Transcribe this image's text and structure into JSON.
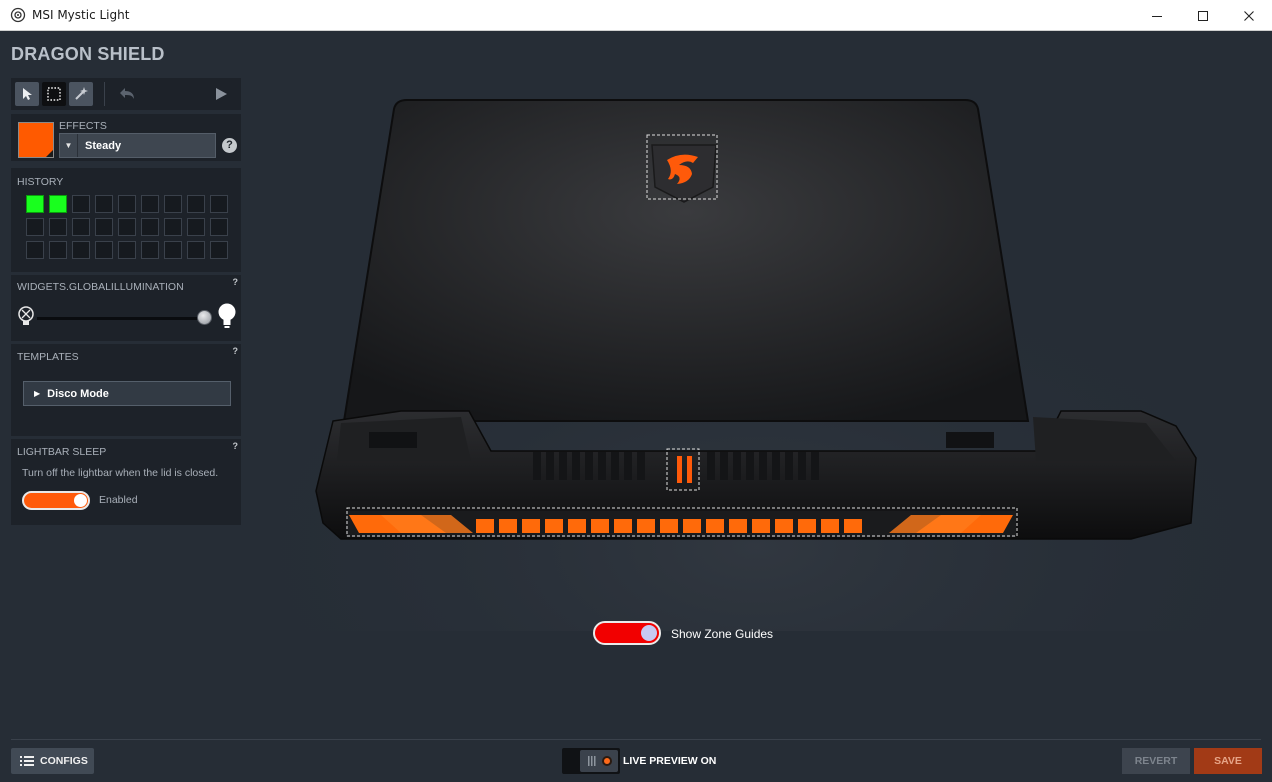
{
  "window": {
    "title": "MSI Mystic Light",
    "controls": {
      "minimize": "—",
      "maximize": "☐",
      "close": "✕"
    }
  },
  "page": {
    "title": "DRAGON SHIELD"
  },
  "toolbar": {
    "tools": [
      "pointer-tool",
      "marquee-tool",
      "magic-wand-tool",
      "undo",
      "play"
    ],
    "active_tool": "marquee-tool"
  },
  "effects": {
    "label": "EFFECTS",
    "selected": "Steady",
    "color": "#ff5a00",
    "help": "?"
  },
  "history": {
    "label": "HISTORY",
    "rows": 3,
    "cols": 9,
    "filled_colors": [
      "#19ff1e",
      "#19ff1e"
    ]
  },
  "illumination": {
    "label": "WIDGETS.GLOBALILLUMINATION",
    "help": "?",
    "level_percent": 100
  },
  "templates": {
    "label": "TEMPLATES",
    "help": "?",
    "selected": "Disco Mode"
  },
  "lightbar_sleep": {
    "label": "LIGHTBAR SLEEP",
    "help": "?",
    "description": "Turn off the lightbar when the lid is closed.",
    "status": "Enabled",
    "enabled": true
  },
  "zone_guides": {
    "label": "Show Zone Guides",
    "enabled": true
  },
  "bottom": {
    "configs": "CONFIGS",
    "live_preview": "LIVE PREVIEW ON",
    "revert": "REVERT",
    "save": "SAVE"
  },
  "colors": {
    "accent": "#ff5a00",
    "zone_toggle": "#f20000",
    "save": "#a23a16",
    "background": "#262d36"
  }
}
